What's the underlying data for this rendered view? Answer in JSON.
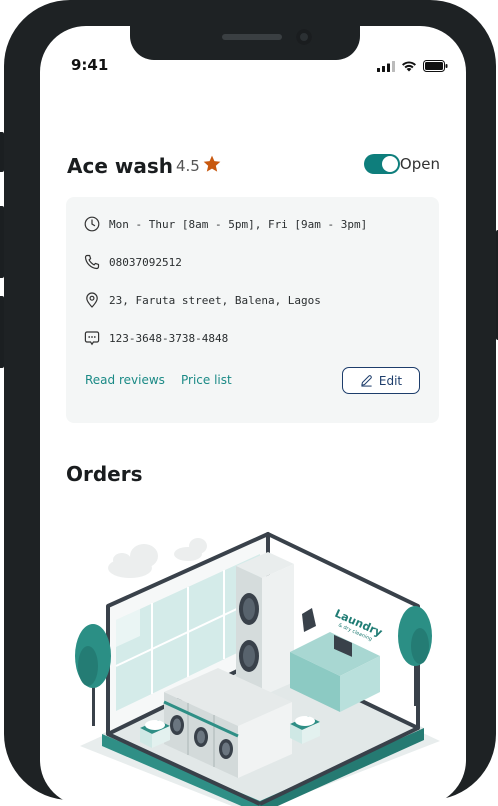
{
  "status_bar": {
    "time": "9:41"
  },
  "shop": {
    "name": "Ace wash",
    "rating": "4.5",
    "status_label": "Open",
    "is_open": true
  },
  "details": {
    "hours": "Mon - Thur [8am - 5pm], Fri [9am - 3pm]",
    "phone": "08037092512",
    "address": "23, Faruta street, Balena, Lagos",
    "account": "123-3648-3738-4848"
  },
  "actions": {
    "read_reviews": "Read reviews",
    "price_list": "Price list",
    "edit": "Edit"
  },
  "orders": {
    "title": "Orders"
  },
  "illustration": {
    "sign_line1": "Laundry",
    "sign_line2": "& dry cleaning"
  },
  "colors": {
    "accent": "#0e7e7c",
    "link": "#1b8a86",
    "edit_border": "#1d3d6b",
    "star": "#c8580f"
  }
}
